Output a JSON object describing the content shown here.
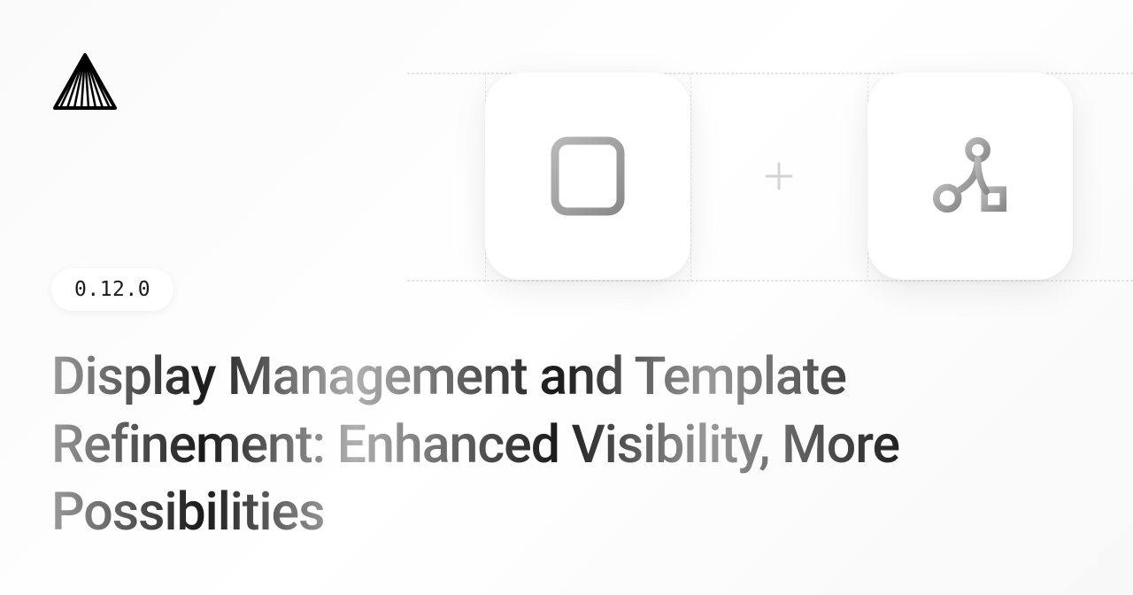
{
  "version": "0.12.0",
  "heading": "Display Management and Template Refinement: Enhanced Visibility, More Possibilities",
  "icons": {
    "logo": "triangle-logo",
    "tile1": "document-icon",
    "tile2": "branch-icon",
    "connector": "plus-icon"
  }
}
